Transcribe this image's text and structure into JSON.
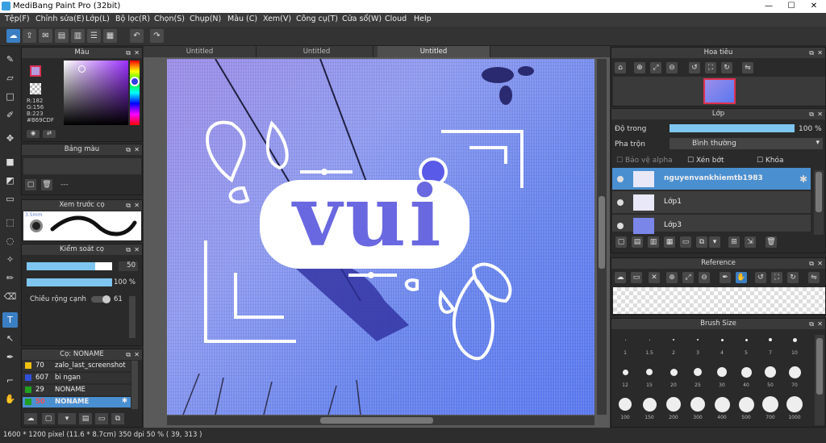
{
  "window": {
    "title": "MediBang Paint Pro (32bit)"
  },
  "menu": [
    "Tệp(F)",
    "Chỉnh sửa(E)",
    "Lớp(L)",
    "Bộ lọc(R)",
    "Chọn(S)",
    "Chụp(N)",
    "Màu (C)",
    "Xem(V)",
    "Công cụ(T)",
    "Cửa sổ(W)",
    "Cloud",
    "Help"
  ],
  "tabs": [
    "Untitled",
    "Untitled",
    "Untitled"
  ],
  "color_panel": {
    "title": "Màu",
    "r": "R:182",
    "g": "G:156",
    "b": "B:223",
    "hex": "#B69CDF"
  },
  "palette_panel": {
    "title": "Bảng màu",
    "value": "---"
  },
  "brush_preview": {
    "title": "Xem trước cọ",
    "size": "3.5mm"
  },
  "brush_control": {
    "title": "Kiểm soát cọ",
    "size_value": "50",
    "opacity_value": "100 %",
    "stroke_label": "Chiều rộng cạnh",
    "stroke_value": "61"
  },
  "brush_list": {
    "title": "Cọ: NONAME",
    "items": [
      {
        "num": "70",
        "label": "zalo_last_screenshot",
        "color": "#f0c010"
      },
      {
        "num": "607",
        "label": "bi ngan",
        "color": "#3050d8"
      },
      {
        "num": "29",
        "label": "NONAME",
        "color": "#20a020"
      },
      {
        "num": "50",
        "label": "NONAME",
        "color": "#20a020"
      }
    ]
  },
  "navigator": {
    "title": "Hoa tiêu"
  },
  "layer_panel": {
    "title": "Lớp",
    "opacity_label": "Độ trong",
    "opacity_value": "100 %",
    "blend_label": "Pha trộn",
    "blend_value": "Bình thường",
    "protect_alpha": "Bảo vệ alpha",
    "clipping": "Xén bớt",
    "lock": "Khóa",
    "layers": [
      {
        "name": "nguyenvankhiemtb1983"
      },
      {
        "name": "Lớp1"
      },
      {
        "name": "Lớp3"
      }
    ]
  },
  "reference": {
    "title": "Reference"
  },
  "brush_size": {
    "title": "Brush Size",
    "sizes": [
      "1",
      "1.5",
      "2",
      "3",
      "4",
      "5",
      "7",
      "10",
      "12",
      "15",
      "20",
      "25",
      "30",
      "40",
      "50",
      "70",
      "100",
      "150",
      "200",
      "300",
      "400",
      "500",
      "700",
      "1000"
    ]
  },
  "canvas_text": {
    "main": "vui"
  },
  "status": {
    "info": "1600 * 1200 pixel   (11.6 * 8.7cm)   350 dpi   50 %   ( 39, 313 )"
  },
  "colors": {
    "accent": "#3a7fc4",
    "fg_color": "#B69CDF",
    "bg_color": "#ffffff"
  }
}
